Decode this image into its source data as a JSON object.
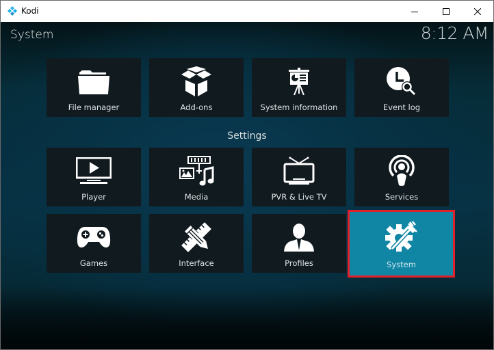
{
  "window": {
    "title": "Kodi",
    "controls": {
      "minimize": "minimize",
      "maximize": "maximize",
      "close": "close"
    }
  },
  "header": {
    "title": "System",
    "clock": "8:12 AM"
  },
  "top_row": [
    {
      "label": "File manager",
      "icon": "folder-icon"
    },
    {
      "label": "Add-ons",
      "icon": "open-box-icon"
    },
    {
      "label": "System information",
      "icon": "presentation-board-icon"
    },
    {
      "label": "Event log",
      "icon": "clock-search-icon"
    }
  ],
  "settings": {
    "heading": "Settings",
    "items": [
      {
        "label": "Player",
        "icon": "monitor-play-icon"
      },
      {
        "label": "Media",
        "icon": "media-film-photo-music-icon"
      },
      {
        "label": "PVR & Live TV",
        "icon": "tv-antenna-icon"
      },
      {
        "label": "Services",
        "icon": "broadcast-person-icon"
      },
      {
        "label": "Games",
        "icon": "gamepad-icon"
      },
      {
        "label": "Interface",
        "icon": "ruler-pencil-icon"
      },
      {
        "label": "Profiles",
        "icon": "person-icon"
      },
      {
        "label": "System",
        "icon": "gear-wrench-icon",
        "focused": true
      }
    ]
  },
  "colors": {
    "focus_bg": "#1185a4",
    "focus_border": "#e3202a",
    "tile_bg": "#101a1f"
  }
}
